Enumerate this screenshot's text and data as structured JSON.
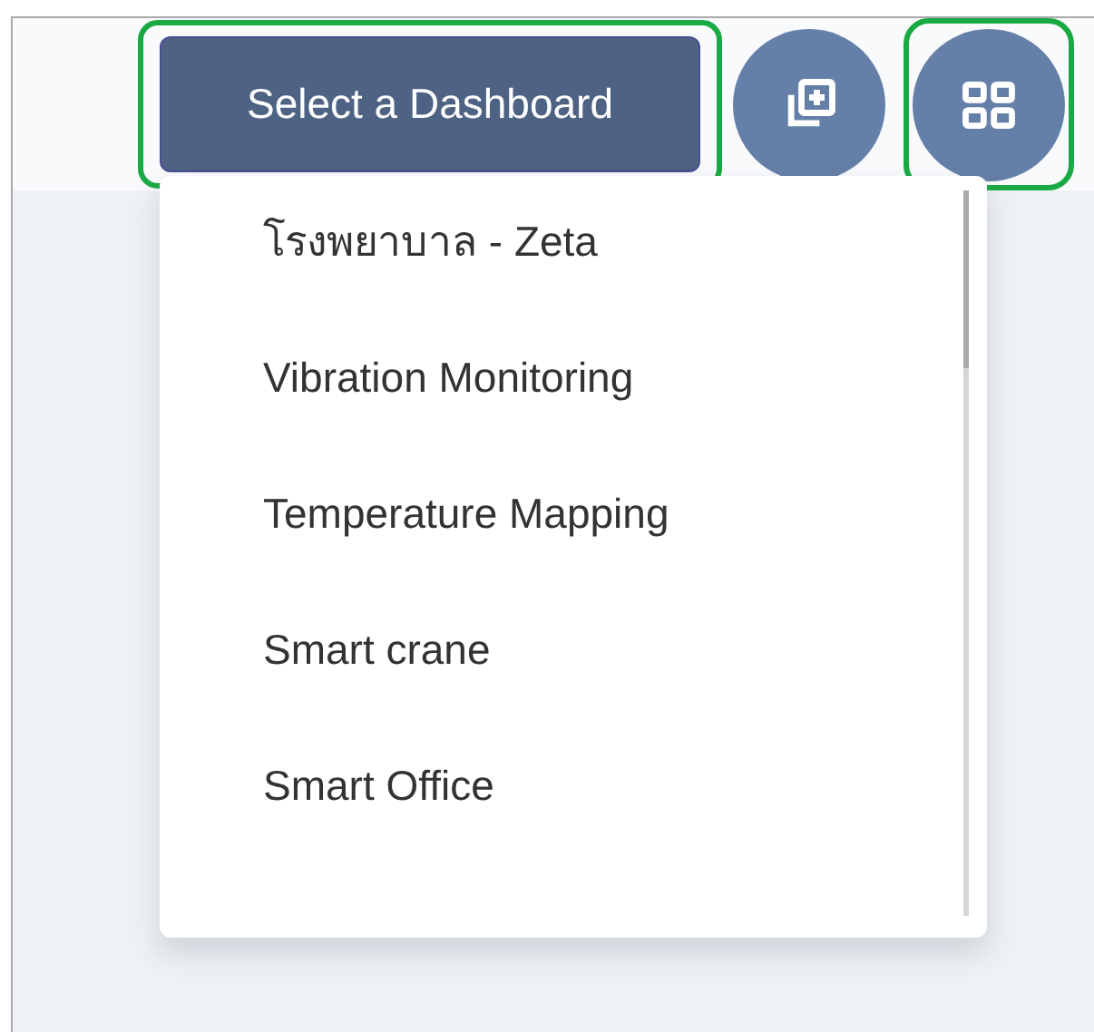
{
  "toolbar": {
    "dashboard_button": {
      "label": "Select a Dashboard",
      "highlighted": true
    },
    "icon_buttons": [
      {
        "kind": "add-copy",
        "highlighted": false
      },
      {
        "kind": "grid",
        "highlighted": true
      }
    ]
  },
  "dropdown": {
    "items": [
      {
        "label": "โรงพยาบาล - Zeta"
      },
      {
        "label": "Vibration Monitoring"
      },
      {
        "label": "Temperature Mapping"
      },
      {
        "label": "Smart crane"
      },
      {
        "label": "Smart Office"
      }
    ]
  }
}
